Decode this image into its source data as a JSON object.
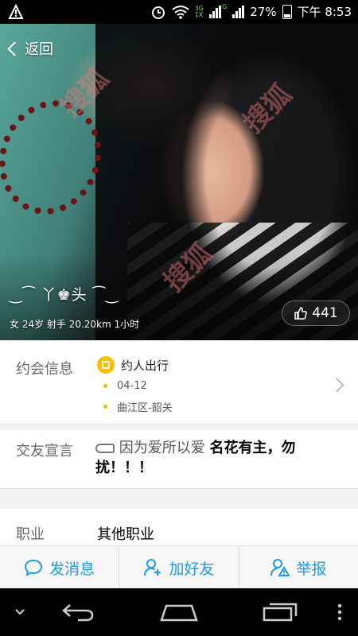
{
  "status_bar": {
    "network_3g": "3G",
    "network_1x": "1X",
    "network_g": "G",
    "battery": "27%",
    "time": "下午 8:53"
  },
  "profile": {
    "back_label": "返回",
    "nickname": "‿⁀ 丫♚头 ⁀‿",
    "meta": "女 24岁 射手 20.20km 1小时",
    "likes": "441",
    "watermark": "搜狐"
  },
  "date_info": {
    "label": "约会信息",
    "type": "约人出行",
    "date": "04-12",
    "location": "曲江区-韶关"
  },
  "declaration": {
    "label": "交友宣言",
    "text_plain": "因为爱所以爱",
    "text_bold_1": "名花有主，勿",
    "text_bold_2": "扰！！！"
  },
  "job": {
    "label": "职业",
    "value": "其他职业"
  },
  "actions": {
    "message": "发消息",
    "add_friend": "加好友",
    "report": "举报"
  },
  "colors": {
    "accent": "#1e9be3",
    "badge_yellow": "#f5c000"
  }
}
